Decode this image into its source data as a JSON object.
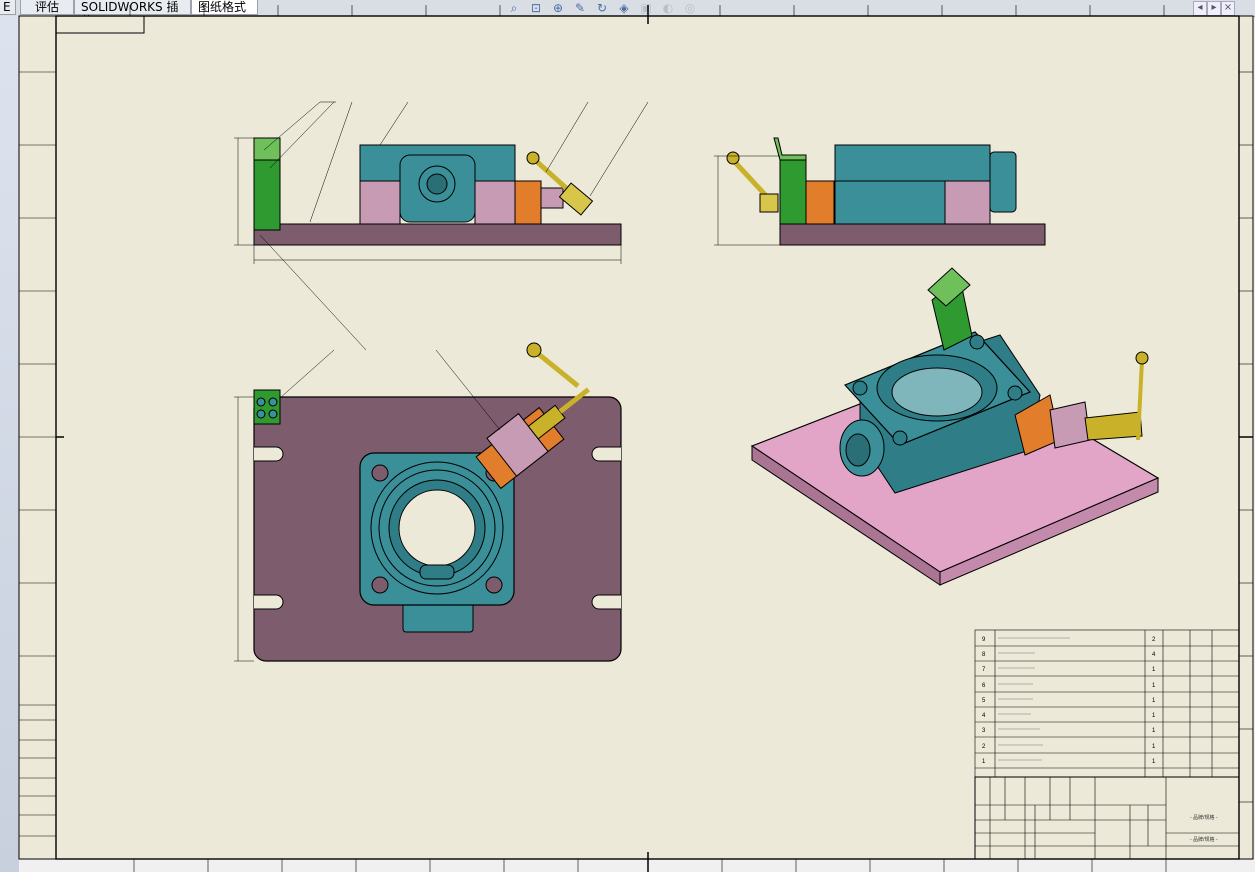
{
  "tabs": [
    {
      "label": "E",
      "active": false
    },
    {
      "label": "评估",
      "active": false
    },
    {
      "label": "SOLIDWORKS 插件",
      "active": false
    },
    {
      "label": "图纸格式",
      "active": true
    }
  ],
  "toolbar_icons": [
    "zoom-fit-icon",
    "zoom-area-icon",
    "zoom-in-icon",
    "pan-icon",
    "rotate-icon",
    "view-orient-icon",
    "display-style-icon",
    "hide-show-icon",
    "appearance-icon"
  ],
  "title_block_note": "- 品牌/规格 -",
  "bom_rows": [
    {
      "no": "9",
      "qty": "2"
    },
    {
      "no": "8",
      "qty": "4"
    },
    {
      "no": "7",
      "qty": "1"
    },
    {
      "no": "6",
      "qty": "1"
    },
    {
      "no": "5",
      "qty": "1"
    },
    {
      "no": "4",
      "qty": "1"
    },
    {
      "no": "3",
      "qty": "1"
    },
    {
      "no": "2",
      "qty": "1"
    },
    {
      "no": "1",
      "qty": "1"
    }
  ],
  "colors": {
    "base_plate": "#7d5c6e",
    "base_plate_iso": "#e2a5c8",
    "housing": "#3a8f98",
    "bracket": "#2f9a2f",
    "clamp_orange": "#e27d2c",
    "handle": "#c9b22a",
    "pink_block": "#c79bb3"
  }
}
